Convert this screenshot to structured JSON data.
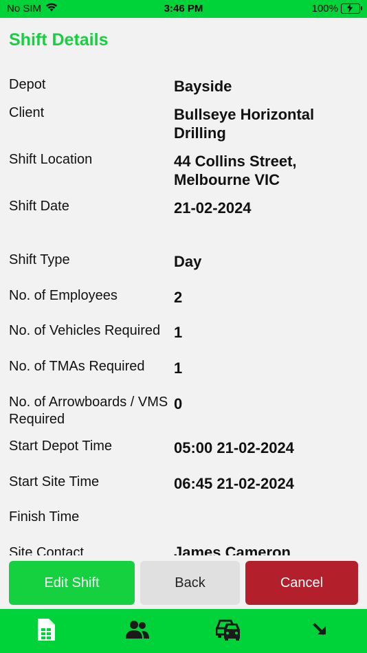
{
  "status_bar": {
    "carrier": "No SIM",
    "time": "3:46 PM",
    "battery": "100%"
  },
  "page": {
    "title": "Shift Details"
  },
  "details": [
    {
      "label": "Depot",
      "value": "Bayside"
    },
    {
      "label": "Client",
      "value": "Bullseye Horizontal Drilling"
    },
    {
      "label": "Shift Location",
      "value": "44 Collins Street, Melbourne VIC"
    },
    {
      "label": "Shift Date",
      "value": "21-02-2024"
    },
    {
      "label": "Shift Type",
      "value": "Day"
    },
    {
      "label": "No. of Employees",
      "value": "2"
    },
    {
      "label": "No. of Vehicles Required",
      "value": "1"
    },
    {
      "label": "No. of TMAs Required",
      "value": "1"
    },
    {
      "label": "No. of Arrowboards / VMS Required",
      "value": "0"
    },
    {
      "label": "Start Depot Time",
      "value": "05:00 21-02-2024"
    },
    {
      "label": "Start Site Time",
      "value": "06:45 21-02-2024"
    },
    {
      "label": "Finish Time",
      "value": ""
    },
    {
      "label": "Site Contact",
      "value": "James Cameron"
    }
  ],
  "buttons": {
    "edit": "Edit Shift",
    "back": "Back",
    "cancel": "Cancel"
  },
  "tabs": [
    {
      "icon": "sheet-icon",
      "active": true
    },
    {
      "icon": "people-icon",
      "active": false
    },
    {
      "icon": "car-icon",
      "active": false
    },
    {
      "icon": "arrow-down-right-icon",
      "active": false
    }
  ],
  "colors": {
    "brand_green": "#00d23a",
    "title_green": "#16d13f",
    "cancel_red": "#b3202b"
  }
}
